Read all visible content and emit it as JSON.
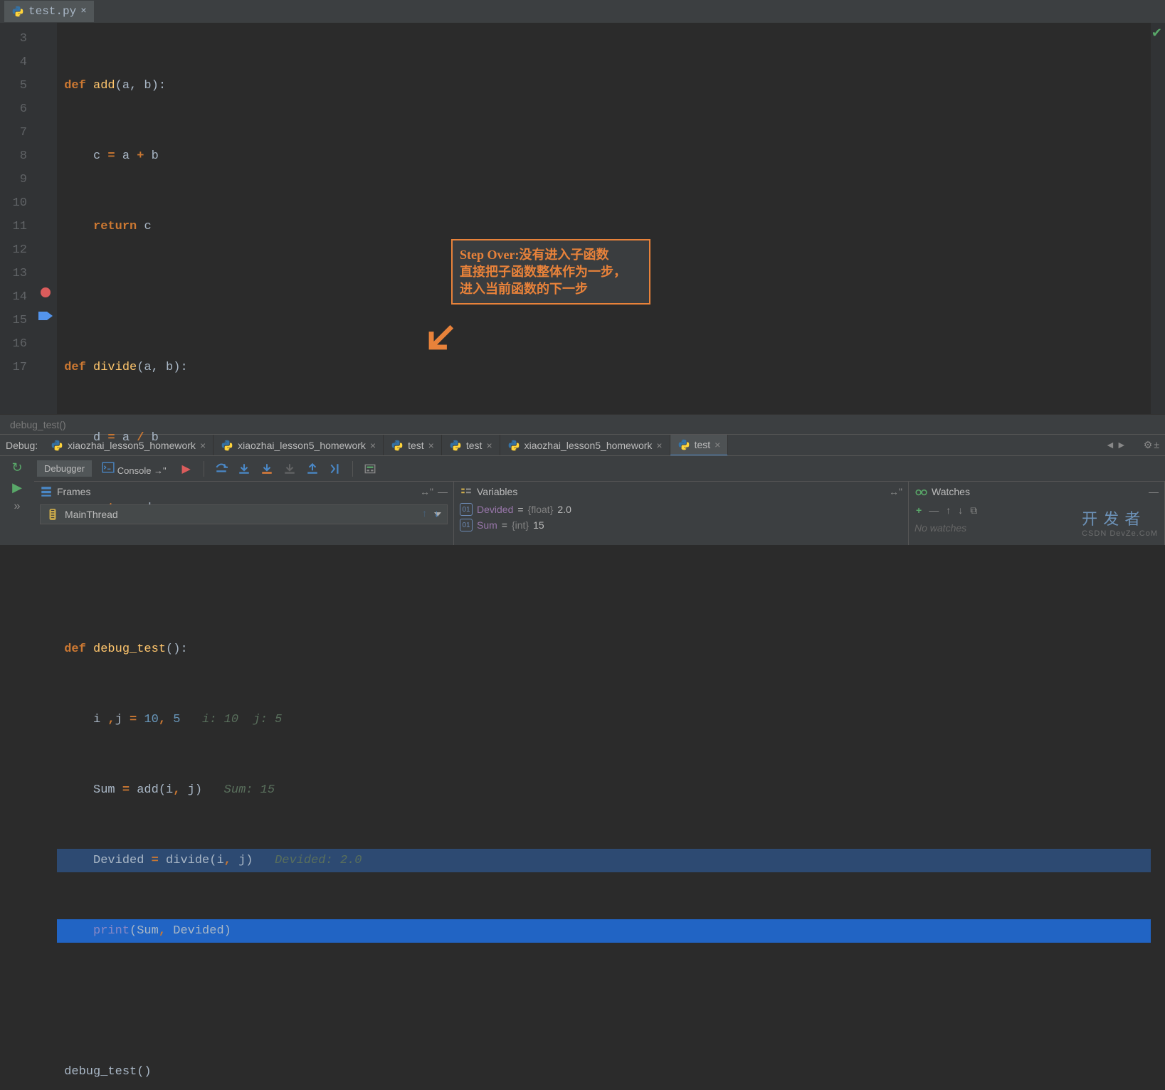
{
  "editor_tab": {
    "filename": "test.py"
  },
  "gutter_lines": [
    "3",
    "4",
    "5",
    "6",
    "7",
    "8",
    "9",
    "10",
    "11",
    "12",
    "13",
    "14",
    "15",
    "16",
    "17"
  ],
  "breakpoint_line": 14,
  "exec_line": 15,
  "code": {
    "l3": {
      "kw": "def ",
      "fn": "add",
      "sig": "(a, b):"
    },
    "l4": {
      "body": "c ",
      "op": "=",
      "rest": " a ",
      "op2": "+",
      "rest2": " b"
    },
    "l5": {
      "kw": "return ",
      "rest": "c"
    },
    "l7": {
      "kw": "def ",
      "fn": "divide",
      "sig": "(a, b):"
    },
    "l8": {
      "body": "d ",
      "op": "=",
      "rest": " a ",
      "op2": "/",
      "rest2": " b"
    },
    "l9": {
      "kw": "return ",
      "rest": "d"
    },
    "l11": {
      "kw": "def ",
      "fn": "debug_test",
      "sig": "():"
    },
    "l12": {
      "body": "i ",
      "comma": ",",
      "body2": "j ",
      "op": "=",
      "sp": " ",
      "n1": "10",
      "c2": ", ",
      "n2": "5",
      "inlay": "   i: 10  j: 5"
    },
    "l13": {
      "body": "Sum ",
      "op": "=",
      "call": " add(i",
      "comma": ", ",
      "arg": "j)",
      "inlay": "   Sum: 15"
    },
    "l14": {
      "body": "Devided ",
      "op": "=",
      "call": " divide(i",
      "comma": ", ",
      "arg": "j)",
      "inlay": "   Devided: 2.0"
    },
    "l15": {
      "fn": "print",
      "args": "(Sum",
      "comma": ", ",
      "args2": "Devided)"
    },
    "l17": {
      "call": "debug_test()"
    },
    "footer": "debug_test()"
  },
  "annotation": {
    "line1": "Step Over:没有进入子函数",
    "line2": "直接把子函数整体作为一步，",
    "line3": "进入当前函数的下一步"
  },
  "debug": {
    "label": "Debug:",
    "tabs": [
      {
        "name": "xiaozhai_lesson5_homework"
      },
      {
        "name": "xiaozhai_lesson5_homework"
      },
      {
        "name": "test"
      },
      {
        "name": "test"
      },
      {
        "name": "xiaozhai_lesson5_homework"
      },
      {
        "name": "test",
        "active": true
      }
    ]
  },
  "toolbar": {
    "debugger": "Debugger",
    "console": "Console"
  },
  "frames": {
    "title": "Frames",
    "thread": "MainThread"
  },
  "variables": {
    "title": "Variables",
    "rows": [
      {
        "name": "Devided",
        "type": "{float}",
        "value": "2.0"
      },
      {
        "name": "Sum",
        "type": "{int}",
        "value": "15"
      }
    ]
  },
  "watches": {
    "title": "Watches",
    "empty": "No watches"
  },
  "watermark": {
    "main": "开 发 者",
    "sub": "CSDN DevZe.CoM"
  }
}
